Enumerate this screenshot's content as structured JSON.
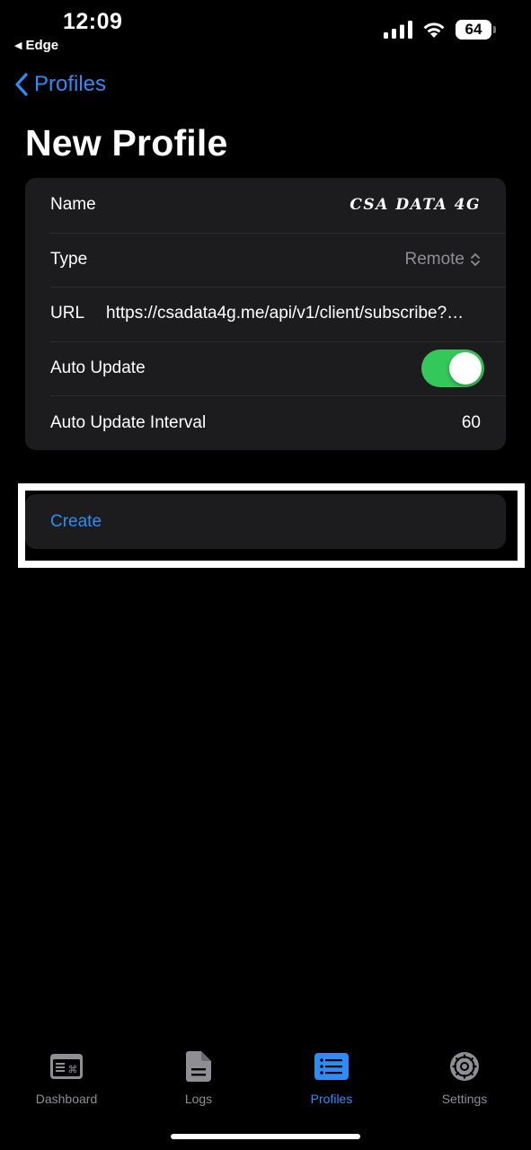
{
  "status_bar": {
    "time": "12:09",
    "back_app": "Edge",
    "battery": "64"
  },
  "nav": {
    "back_label": "Profiles"
  },
  "page": {
    "title": "New Profile"
  },
  "form": {
    "name": {
      "label": "Name",
      "value": "CSA DATA 4G"
    },
    "type": {
      "label": "Type",
      "value": "Remote"
    },
    "url": {
      "label": "URL",
      "value": "https://csadata4g.me/api/v1/client/subscribe?…"
    },
    "auto_update": {
      "label": "Auto Update",
      "enabled": true
    },
    "auto_update_interval": {
      "label": "Auto Update Interval",
      "value": "60"
    }
  },
  "actions": {
    "create_label": "Create"
  },
  "tabbar": {
    "tabs": [
      {
        "label": "Dashboard",
        "icon": "dashboard-icon",
        "active": false
      },
      {
        "label": "Logs",
        "icon": "document-icon",
        "active": false
      },
      {
        "label": "Profiles",
        "icon": "list-icon",
        "active": true
      },
      {
        "label": "Settings",
        "icon": "gear-icon",
        "active": false
      }
    ]
  },
  "colors": {
    "accent": "#2f8cf5",
    "toggle_on": "#34c759",
    "card": "#1c1c1e",
    "secondary_text": "#8e8e93"
  }
}
